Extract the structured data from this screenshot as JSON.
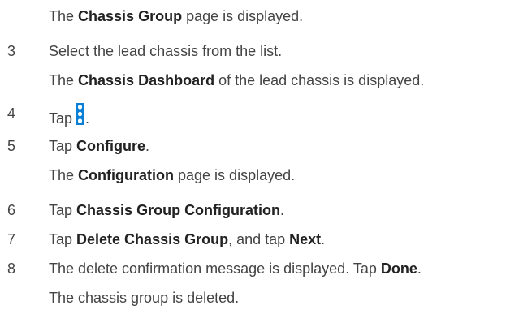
{
  "steps": [
    {
      "num": "",
      "parts": [
        {
          "t": "The ",
          "b": false
        },
        {
          "t": "Chassis Group",
          "b": true
        },
        {
          "t": " page is displayed.",
          "b": false
        }
      ]
    },
    {
      "num": "3",
      "parts": [
        {
          "t": "Select the lead chassis from the list.",
          "b": false
        }
      ]
    },
    {
      "num": "",
      "parts": [
        {
          "t": "The ",
          "b": false
        },
        {
          "t": "Chassis Dashboard",
          "b": true
        },
        {
          "t": " of the lead chassis is displayed.",
          "b": false
        }
      ]
    },
    {
      "num": "4",
      "parts": [
        {
          "t": "Tap",
          "b": false
        },
        {
          "icon": "kebab-menu-icon"
        },
        {
          "t": ".",
          "b": false
        }
      ]
    },
    {
      "num": "5",
      "parts": [
        {
          "t": "Tap ",
          "b": false
        },
        {
          "t": "Configure",
          "b": true
        },
        {
          "t": ".",
          "b": false
        }
      ]
    },
    {
      "num": "",
      "parts": [
        {
          "t": "The ",
          "b": false
        },
        {
          "t": "Configuration",
          "b": true
        },
        {
          "t": " page is displayed.",
          "b": false
        }
      ]
    },
    {
      "num": "6",
      "parts": [
        {
          "t": "Tap ",
          "b": false
        },
        {
          "t": "Chassis Group Configuration",
          "b": true
        },
        {
          "t": ".",
          "b": false
        }
      ]
    },
    {
      "num": "7",
      "parts": [
        {
          "t": "Tap ",
          "b": false
        },
        {
          "t": "Delete Chassis Group",
          "b": true
        },
        {
          "t": ", and tap ",
          "b": false
        },
        {
          "t": "Next",
          "b": true
        },
        {
          "t": ".",
          "b": false
        }
      ]
    },
    {
      "num": "8",
      "parts": [
        {
          "t": "The delete confirmation message is displayed. Tap ",
          "b": false
        },
        {
          "t": "Done",
          "b": true
        },
        {
          "t": ".",
          "b": false
        }
      ]
    },
    {
      "num": "",
      "parts": [
        {
          "t": "The chassis group is deleted.",
          "b": false
        }
      ]
    }
  ],
  "colors": {
    "text": "#444444",
    "bold_text": "#222222",
    "icon_fill": "#0a7fd8"
  }
}
